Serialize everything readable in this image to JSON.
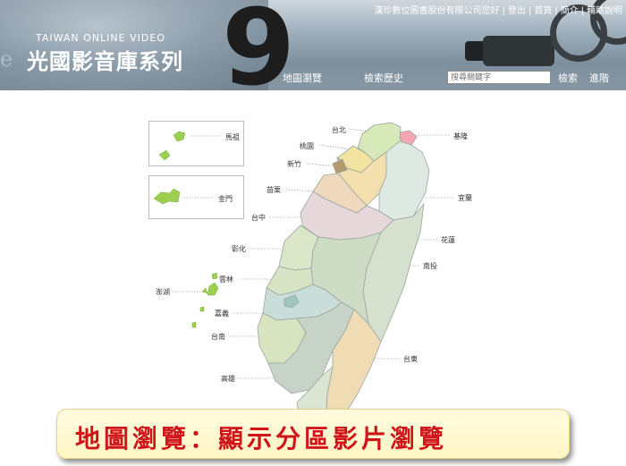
{
  "header": {
    "brand_en": "TAIWAN ONLINE VIDEO",
    "brand_zh": "光國影音庫系列",
    "decor_ghost_text": "e",
    "top_links": [
      {
        "label": "漢珍數位圖書股份有限公司您好"
      },
      {
        "label": "登出"
      },
      {
        "label": "首頁"
      },
      {
        "label": "簡介"
      },
      {
        "label": "輔助說明"
      }
    ]
  },
  "nav": {
    "map_browse": "地圖瀏覽",
    "search_history": "檢索歷史",
    "search_placeholder": "搜尋關鍵字",
    "search_button": "檢索",
    "advanced_button": "進階"
  },
  "map": {
    "insets": {
      "matsu": "馬祖",
      "kinmen": "金門"
    },
    "regions": {
      "taipei": "台北",
      "keelung": "基隆",
      "taoyuan": "桃園",
      "hsinchu": "新竹",
      "yilan": "宜蘭",
      "miaoli": "苗栗",
      "taichung": "台中",
      "hualien": "花蓮",
      "changhua": "彰化",
      "nantou": "南投",
      "yunlin": "雲林",
      "penghu": "澎湖",
      "chiayi": "嘉義",
      "tainan": "台南",
      "taitung": "台東",
      "kaohsiung": "高雄"
    },
    "colors": {
      "inset_island": "#9ccf4e",
      "taipei": "#d7e8b9",
      "keelung": "#f2a7b3",
      "taoyuan": "#f2e4a0",
      "hsinchu_county": "#f2dfad",
      "hsinchu_city": "#b59a6d",
      "yilan": "#dfe9e4",
      "miaoli": "#f0d8bf",
      "taichung": "#e6d7da",
      "hualien": "#d6e0cf",
      "changhua": "#dbe6c9",
      "nantou": "#cfdcc5",
      "yunlin": "#d6e3c4",
      "chiayi": "#c9ddd9",
      "chiayi_city": "#9fc7bf",
      "tainan": "#d8e4c0",
      "kaohsiung": "#c8d3c7",
      "taitung": "#efdcb5",
      "pingtung": "#dbe5d3"
    }
  },
  "caption": "地圖瀏覽：顯示分區影片瀏覽"
}
